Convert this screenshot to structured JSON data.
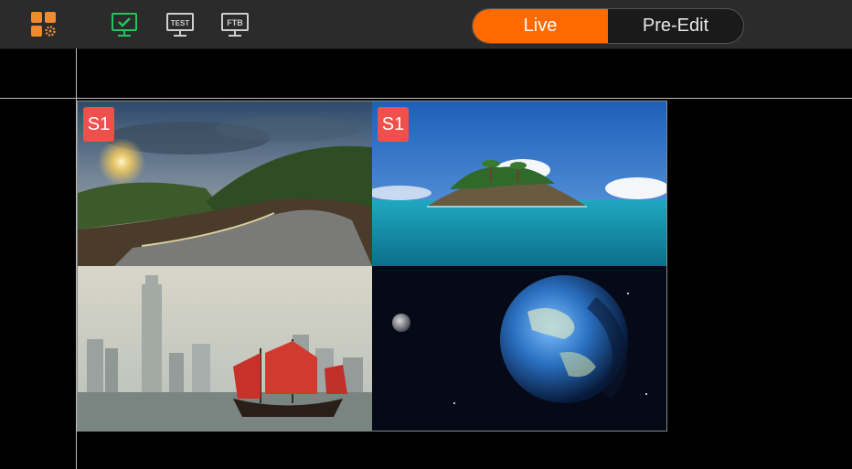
{
  "toolbar": {
    "icons": [
      "layout-grid-icon",
      "monitor-check-icon",
      "test-monitor-icon",
      "ftb-monitor-icon"
    ],
    "test_label": "TEST",
    "ftb_label": "FTB",
    "accent": "#ff6a00",
    "check_color": "#22c55e"
  },
  "mode": {
    "live_label": "Live",
    "pre_edit_label": "Pre-Edit",
    "selected": "Live"
  },
  "screens": [
    {
      "badge": "S1",
      "scene": "sunset-road"
    },
    {
      "badge": "S1",
      "scene": "tropical-island"
    },
    {
      "badge": "",
      "scene": "harbor-junk-boat"
    },
    {
      "badge": "",
      "scene": "earth-from-space"
    }
  ]
}
